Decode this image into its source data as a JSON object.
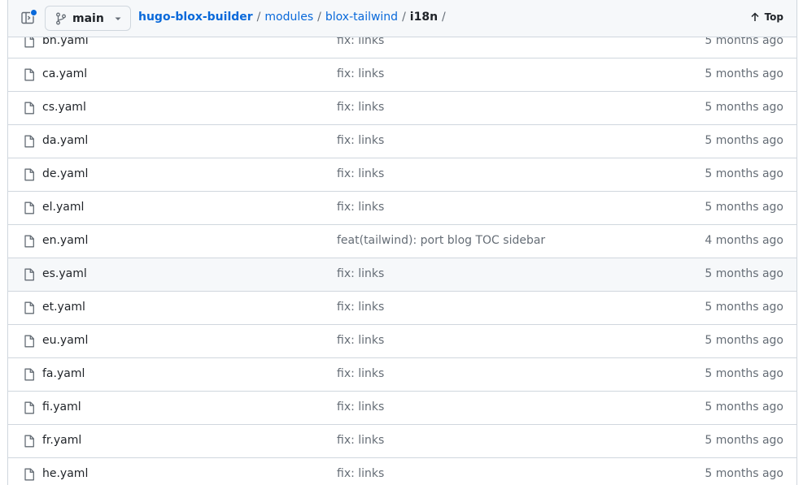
{
  "header": {
    "branch": "main",
    "breadcrumb": {
      "repo": "hugo-blox-builder",
      "sep": "/",
      "parts": [
        "modules",
        "blox-tailwind"
      ],
      "current": "i18n"
    },
    "top_label": "Top"
  },
  "files": [
    {
      "name": "bn.yaml",
      "message": "fix: links",
      "date": "5 months ago"
    },
    {
      "name": "ca.yaml",
      "message": "fix: links",
      "date": "5 months ago"
    },
    {
      "name": "cs.yaml",
      "message": "fix: links",
      "date": "5 months ago"
    },
    {
      "name": "da.yaml",
      "message": "fix: links",
      "date": "5 months ago"
    },
    {
      "name": "de.yaml",
      "message": "fix: links",
      "date": "5 months ago"
    },
    {
      "name": "el.yaml",
      "message": "fix: links",
      "date": "5 months ago"
    },
    {
      "name": "en.yaml",
      "message": "feat(tailwind): port blog TOC sidebar",
      "date": "4 months ago"
    },
    {
      "name": "es.yaml",
      "message": "fix: links",
      "date": "5 months ago"
    },
    {
      "name": "et.yaml",
      "message": "fix: links",
      "date": "5 months ago"
    },
    {
      "name": "eu.yaml",
      "message": "fix: links",
      "date": "5 months ago"
    },
    {
      "name": "fa.yaml",
      "message": "fix: links",
      "date": "5 months ago"
    },
    {
      "name": "fi.yaml",
      "message": "fix: links",
      "date": "5 months ago"
    },
    {
      "name": "fr.yaml",
      "message": "fix: links",
      "date": "5 months ago"
    },
    {
      "name": "he.yaml",
      "message": "fix: links",
      "date": "5 months ago"
    }
  ],
  "colors": {
    "accent": "#0969da",
    "muted": "#656d76",
    "border": "#d0d7de",
    "header_bg": "#f6f8fa"
  }
}
